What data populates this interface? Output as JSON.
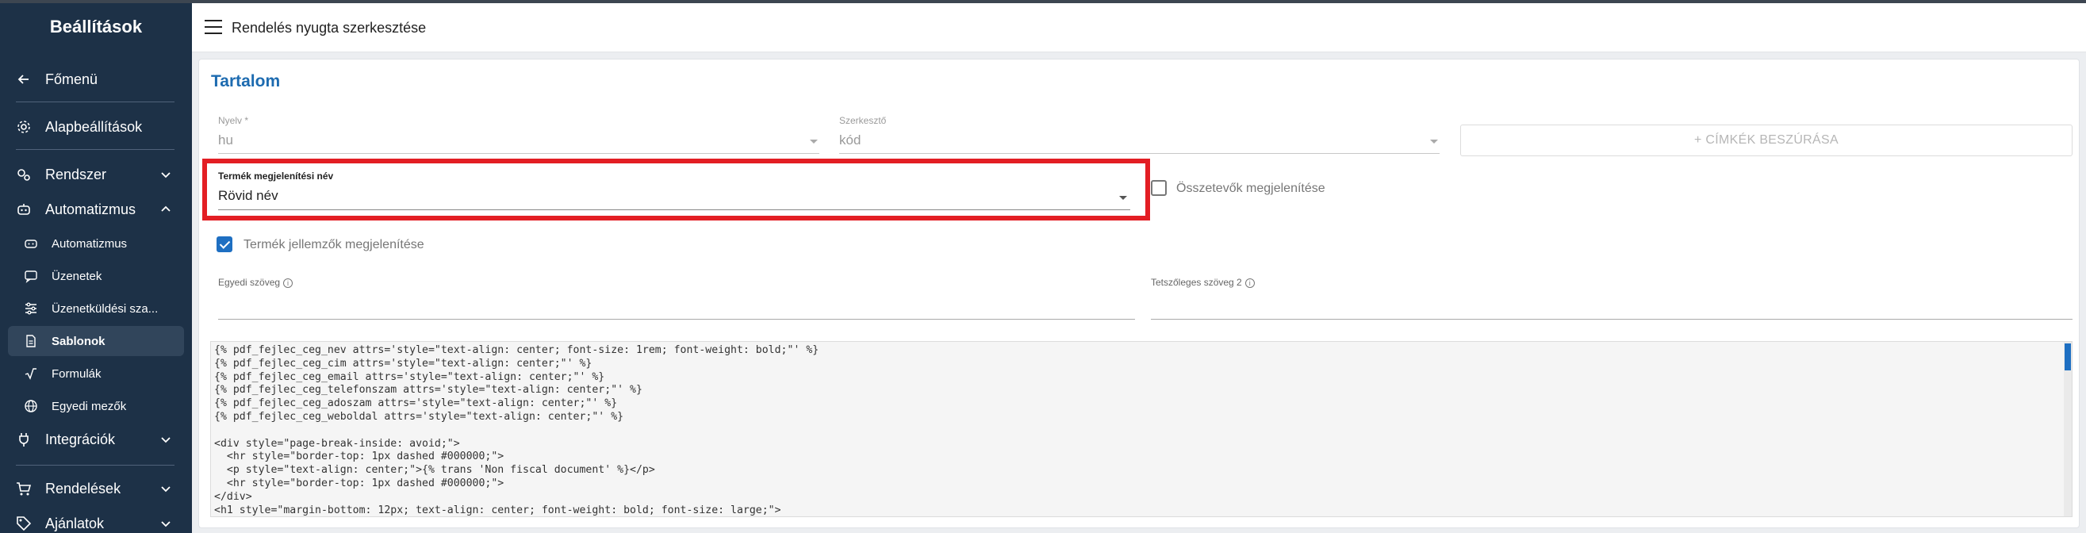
{
  "sidebar": {
    "title": "Beállítások",
    "items": {
      "main_menu": "Főmenü",
      "basic_settings": "Alapbeállítások",
      "system": "Rendszer",
      "automation": "Automatizmus",
      "integrations": "Integrációk",
      "orders": "Rendelések",
      "offers": "Ajánlatok"
    },
    "sub_items": {
      "automation": "Automatizmus",
      "messages": "Üzenetek",
      "message_sending": "Üzenetküldési sza...",
      "templates": "Sablonok",
      "formulas": "Formulák",
      "custom_fields": "Egyedi mezők"
    }
  },
  "header": {
    "title": "Rendelés nyugta szerkesztése"
  },
  "content": {
    "title": "Tartalom",
    "language": {
      "label": "Nyelv *",
      "value": "hu"
    },
    "editor": {
      "label": "Szerkesztő",
      "value": "kód"
    },
    "insert_tags_button": "+ CÍMKÉK BESZÚRÁSA",
    "product_display_name": {
      "label": "Termék megjelenítési név",
      "value": "Rövid név"
    },
    "show_ingredients": {
      "label": "Összetevők megjelenítése",
      "checked": false
    },
    "show_product_features": {
      "label": "Termék jellemzők megjelenítése",
      "checked": true
    },
    "custom_text": {
      "label": "Egyedi szöveg",
      "value": ""
    },
    "arbitrary_text_2": {
      "label": "Tetszőleges szöveg 2",
      "value": ""
    },
    "code_lines": [
      "{% pdf_fejlec_ceg_nev attrs='style=\"text-align: center; font-size: 1rem; font-weight: bold;\"' %}",
      "{% pdf_fejlec_ceg_cim attrs='style=\"text-align: center;\"' %}",
      "{% pdf_fejlec_ceg_email attrs='style=\"text-align: center;\"' %}",
      "{% pdf_fejlec_ceg_telefonszam attrs='style=\"text-align: center;\"' %}",
      "{% pdf_fejlec_ceg_adoszam attrs='style=\"text-align: center;\"' %}",
      "{% pdf_fejlec_ceg_weboldal attrs='style=\"text-align: center;\"' %}",
      "",
      "<div style=\"page-break-inside: avoid;\">",
      "  <hr style=\"border-top: 1px dashed #000000;\">",
      "  <p style=\"text-align: center;\">{% trans 'Non fiscal document' %}</p>",
      "  <hr style=\"border-top: 1px dashed #000000;\">",
      "</div>",
      "<h1 style=\"margin-bottom: 12px; text-align: center; font-weight: bold; font-size: large;\">"
    ]
  },
  "colors": {
    "sidebar_bg": "#1d3147",
    "accent": "#1e6fc2",
    "title_blue": "#1d6bb0",
    "highlight_red": "#e31e24"
  }
}
